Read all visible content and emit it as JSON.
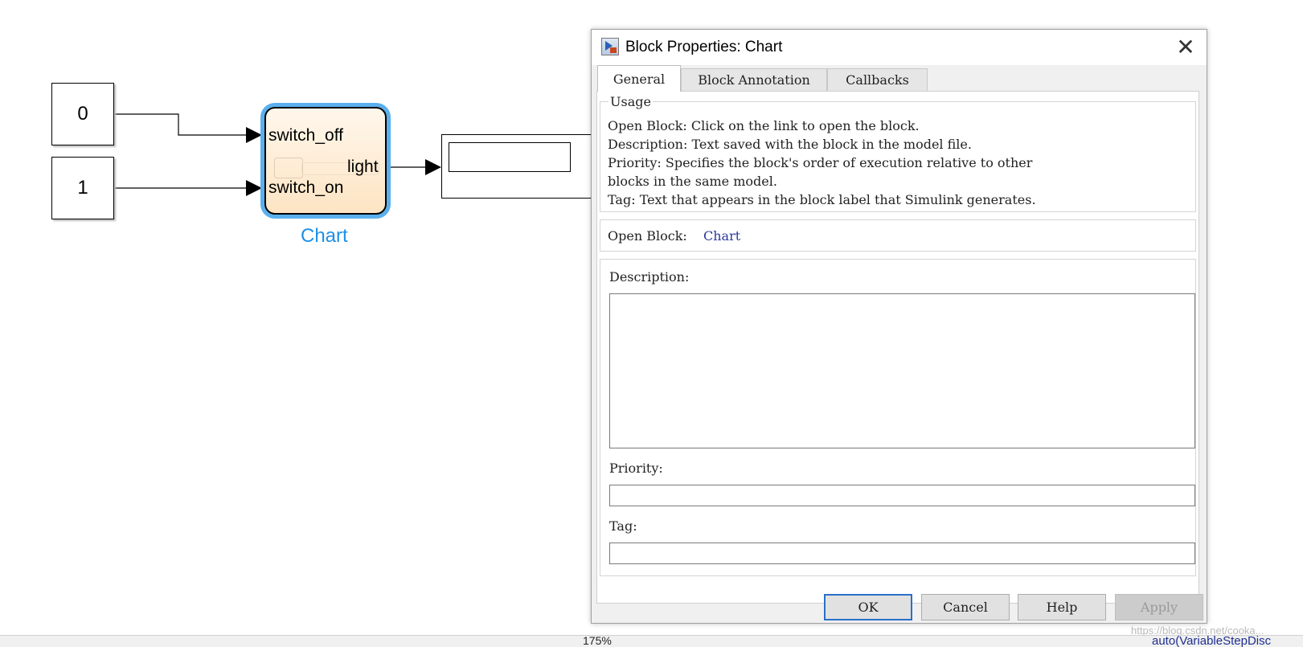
{
  "canvas": {
    "constants": [
      {
        "value": "0"
      },
      {
        "value": "1"
      }
    ],
    "chart": {
      "name": "Chart",
      "inputs": [
        "switch_off",
        "switch_on"
      ],
      "output": "light"
    }
  },
  "dialog": {
    "title": "Block Properties: Chart",
    "tabs": [
      "General",
      "Block Annotation",
      "Callbacks"
    ],
    "active_tab": "General",
    "usage": {
      "legend": "Usage",
      "lines": [
        "Open Block: Click on the link to open the block.",
        "Description: Text saved with the block in the model file.",
        "Priority: Specifies the block's order of execution relative to other",
        "blocks in the same model.",
        "Tag: Text that appears in the block label that Simulink generates."
      ]
    },
    "open_block": {
      "label": "Open Block:",
      "link": "Chart"
    },
    "description": {
      "label": "Description:",
      "value": ""
    },
    "priority": {
      "label": "Priority:",
      "value": ""
    },
    "tag": {
      "label": "Tag:",
      "value": ""
    },
    "buttons": {
      "ok": "OK",
      "cancel": "Cancel",
      "help": "Help",
      "apply": "Apply"
    }
  },
  "statusbar": {
    "zoom": "175%",
    "solver": "auto(VariableStepDisc"
  },
  "watermark": "https://blog.csdn.net/cooka..."
}
